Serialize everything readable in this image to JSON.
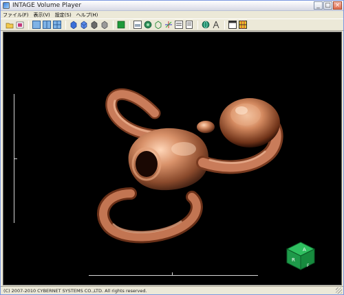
{
  "window": {
    "title": "INTAGE Volume Player",
    "minimize": "_",
    "maximize": "□",
    "close": "×"
  },
  "menu": [
    {
      "label": "ファイル(F)"
    },
    {
      "label": "表示(V)"
    },
    {
      "label": "設定(S)"
    },
    {
      "label": "ヘルプ(H)"
    }
  ],
  "toolbar": {
    "icons": [
      "open-folder-icon",
      "image-icon",
      "layout-single-icon",
      "layout-two-pane-icon",
      "layout-four-pane-icon",
      "cube-solid-icon",
      "cube-blue-icon",
      "cube-gray-icon",
      "cube-shaded-icon",
      "green-square-icon",
      "mpr-icon",
      "render-mode-icon",
      "wireframe-icon",
      "axes-icon",
      "text-icon",
      "document-icon",
      "globe-icon",
      "measure-icon",
      "window-icon",
      "grid-color-icon"
    ]
  },
  "viewport": {
    "background": "#000000",
    "volume_color": "#c97c5a"
  },
  "orientation_cube": {
    "top_label": "A",
    "left_label": "R",
    "right_label": "F",
    "color": "#1f9a4a"
  },
  "status": {
    "copyright": "(C) 2007-2010 CYBERNET SYSTEMS CO.,LTD. All rights reserved."
  }
}
